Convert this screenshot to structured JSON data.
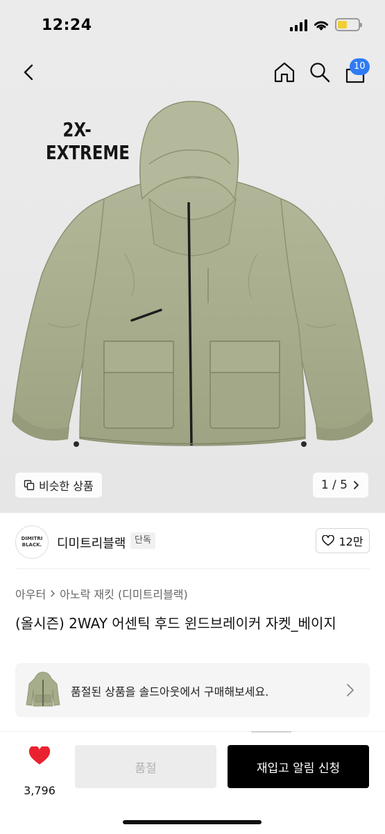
{
  "status_bar": {
    "time": "12:24"
  },
  "nav": {
    "back_icon": "chevron-left-icon",
    "home_icon": "home-icon",
    "search_icon": "search-icon",
    "cart_icon": "cart-icon",
    "cart_count": "10"
  },
  "hero": {
    "brand_text_line1": "2X-",
    "brand_text_line2": "EXTREME",
    "similar_label": "비슷한 상품",
    "page_indicator": "1 / 5"
  },
  "brand": {
    "logo_text_line1": "DIMITRI",
    "logo_text_line2": "BLACK.",
    "name": "디미트리블랙",
    "tag": "단독",
    "like_count": "12만"
  },
  "product": {
    "breadcrumb": [
      "아우터",
      "아노락 재킷 (디미트리블랙)"
    ],
    "title": "(올시즌) 2WAY 어센틱 후드 윈드브레이커 자켓_베이지",
    "soldout_message": "품절된 상품을 솔드아웃에서 구매해보세요."
  },
  "bottom_bar": {
    "wish_count": "3,796",
    "soldout_label": "품절",
    "restock_label": "재입고 알림 신청"
  },
  "colors": {
    "accent_blue": "#2f7bf5",
    "heart_red": "#e8232f",
    "battery_yellow": "#f2cd36",
    "jacket_olive": "#a6ad8a"
  }
}
